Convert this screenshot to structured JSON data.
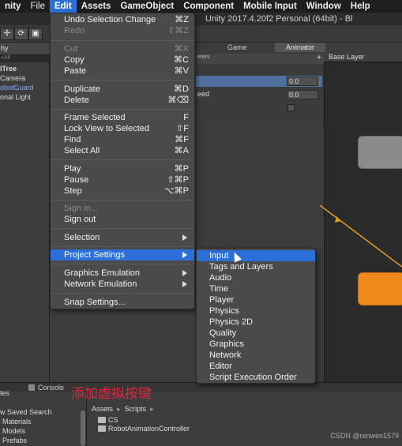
{
  "menubar": {
    "app": "nity",
    "items": [
      "File",
      "Edit",
      "Assets",
      "GameObject",
      "Component",
      "Mobile Input",
      "Window",
      "Help"
    ]
  },
  "window_title": "Unity 2017.4.20f2 Personal (64bit) - Bl",
  "hierarchy": {
    "tab": "hy",
    "search": "⌕All",
    "rows": [
      "lTree",
      "Camera",
      "obotGuard",
      "onal Light"
    ]
  },
  "tabs": [
    "Game",
    "Animator"
  ],
  "inspector": {
    "header": "eters",
    "params": [
      {
        "name": "",
        "value": "0.0"
      },
      {
        "name": "eed",
        "value": "0.0"
      }
    ]
  },
  "animator": {
    "layer": "Base Layer"
  },
  "edit_menu": {
    "groups": [
      [
        {
          "label": "Undo Selection Change",
          "shortcut": "⌘Z",
          "disabled": false
        },
        {
          "label": "Redo",
          "shortcut": "⇧⌘Z",
          "disabled": true
        }
      ],
      [
        {
          "label": "Cut",
          "shortcut": "⌘X",
          "disabled": true
        },
        {
          "label": "Copy",
          "shortcut": "⌘C",
          "disabled": false
        },
        {
          "label": "Paste",
          "shortcut": "⌘V",
          "disabled": false
        }
      ],
      [
        {
          "label": "Duplicate",
          "shortcut": "⌘D",
          "disabled": false
        },
        {
          "label": "Delete",
          "shortcut": "⌘⌫",
          "disabled": false
        }
      ],
      [
        {
          "label": "Frame Selected",
          "shortcut": "F",
          "disabled": false
        },
        {
          "label": "Lock View to Selected",
          "shortcut": "⇧F",
          "disabled": false
        },
        {
          "label": "Find",
          "shortcut": "⌘F",
          "disabled": false
        },
        {
          "label": "Select All",
          "shortcut": "⌘A",
          "disabled": false
        }
      ],
      [
        {
          "label": "Play",
          "shortcut": "⌘P",
          "disabled": false
        },
        {
          "label": "Pause",
          "shortcut": "⇧⌘P",
          "disabled": false
        },
        {
          "label": "Step",
          "shortcut": "⌥⌘P",
          "disabled": false
        }
      ],
      [
        {
          "label": "Sign in...",
          "shortcut": "",
          "disabled": true
        },
        {
          "label": "Sign out",
          "shortcut": "",
          "disabled": false
        }
      ],
      [
        {
          "label": "Selection",
          "shortcut": "",
          "submenu": true
        }
      ],
      [
        {
          "label": "Project Settings",
          "shortcut": "",
          "submenu": true,
          "highlighted": true
        }
      ],
      [
        {
          "label": "Graphics Emulation",
          "shortcut": "",
          "submenu": true
        },
        {
          "label": "Network Emulation",
          "shortcut": "",
          "submenu": true
        }
      ],
      [
        {
          "label": "Snap Settings...",
          "shortcut": ""
        }
      ]
    ]
  },
  "project_settings_menu": {
    "items": [
      "Input",
      "Tags and Layers",
      "Audio",
      "Time",
      "Player",
      "Physics",
      "Physics 2D",
      "Quality",
      "Graphics",
      "Network",
      "Editor",
      "Script Execution Order"
    ],
    "highlighted_index": 0
  },
  "bottom": {
    "console_tab": "Console",
    "left_rows": [
      "tes",
      "w Saved Search",
      "Materials",
      "Models",
      "Prefabs"
    ],
    "breadcrumb": [
      "Assets",
      "Scripts"
    ],
    "files": [
      "CS",
      "RobotAnimationController"
    ],
    "annotation": "添加虚拟按键",
    "watermark": "CSDN @renwen1579"
  },
  "colors": {
    "highlight": "#2d6fd9",
    "state_orange": "#ef8a1a",
    "state_gray": "#8b8b8b",
    "annotation_red": "#e0243a"
  }
}
